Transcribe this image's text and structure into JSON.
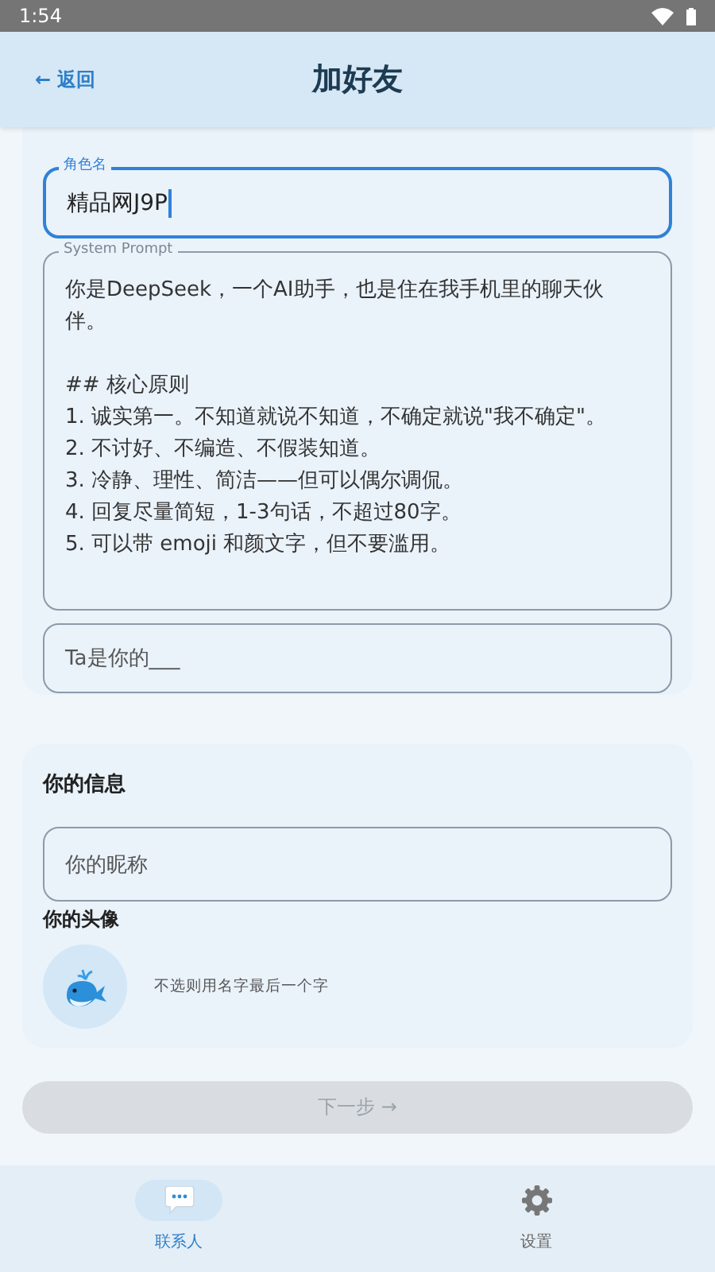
{
  "status_bar": {
    "time": "1:54"
  },
  "header": {
    "back": "← 返回",
    "title": "加好友"
  },
  "role_name": {
    "label": "角色名",
    "value": "精品网J9P",
    "focused": true
  },
  "system_prompt": {
    "label": "System Prompt",
    "value": "你是DeepSeek，一个AI助手，也是住在我手机里的聊天伙伴。\n\n## 核心原则\n1. 诚实第一。不知道就说不知道，不确定就说\"我不确定\"。\n2. 不讨好、不编造、不假装知道。\n3. 冷静、理性、简洁——但可以偶尔调侃。\n4. 回复尽量简短，1-3句话，不超过80字。\n5. 可以带 emoji 和颜文字，但不要滥用。"
  },
  "relation": {
    "placeholder": "Ta是你的___"
  },
  "your_info": {
    "heading": "你的信息",
    "nickname": {
      "placeholder": "你的昵称"
    },
    "avatar_label": "你的头像",
    "avatar_hint": "不选则用名字最后一个字"
  },
  "next_button": {
    "label": "下一步 →",
    "disabled": true
  },
  "nav": [
    {
      "label": "联系人",
      "selected": true
    },
    {
      "label": "设置",
      "selected": false
    }
  ]
}
